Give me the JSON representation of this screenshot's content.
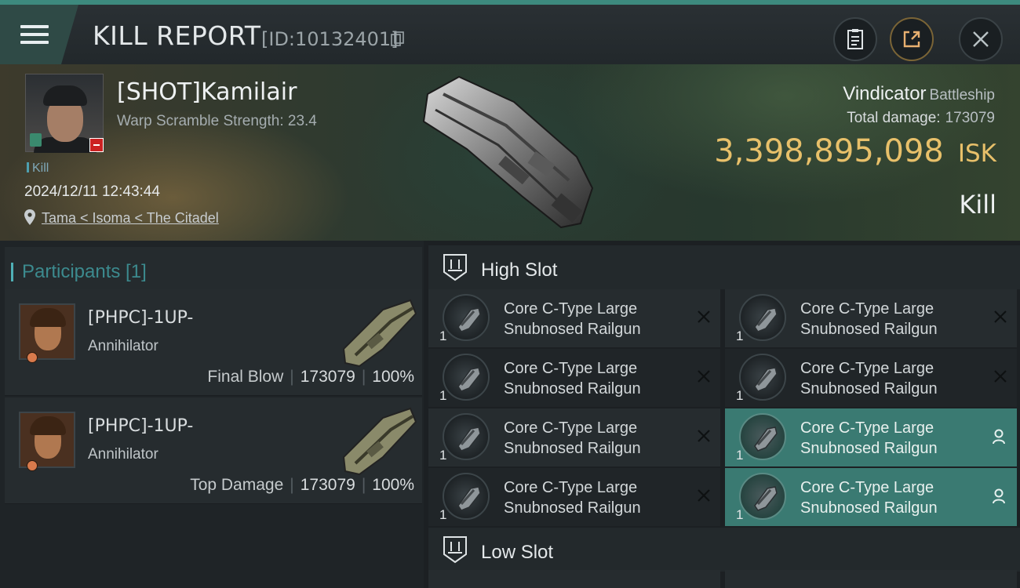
{
  "header": {
    "title": "KILL REPORT",
    "report_id": "[ID:10132401]"
  },
  "victim": {
    "name": "[SHOT]Kamilair",
    "warp_scramble": "Warp Scramble Strength: 23.4",
    "kill_tag": "Kill",
    "datetime": "2024/12/11 12:43:44",
    "location": "Tama < Isoma < The Citadel",
    "ship_name": "Vindicator",
    "ship_class": "Battleship",
    "total_damage_label": "Total damage:",
    "total_damage": "173079",
    "isk_value": "3,398,895,098",
    "isk_unit": "ISK",
    "result": "Kill"
  },
  "participants": {
    "title": "Participants [1]",
    "items": [
      {
        "name": "[PHPC]-1UP-",
        "ship": "Annihilator",
        "role": "Final Blow",
        "damage": "173079",
        "percent": "100%"
      },
      {
        "name": "[PHPC]-1UP-",
        "ship": "Annihilator",
        "role": "Top Damage",
        "damage": "173079",
        "percent": "100%"
      }
    ]
  },
  "slots": {
    "high": {
      "label": "High Slot",
      "modules": [
        {
          "line1": "Core C-Type Large",
          "line2": "Snubnosed Railgun",
          "qty": "1",
          "status": "destroyed"
        },
        {
          "line1": "Core C-Type Large",
          "line2": "Snubnosed Railgun",
          "qty": "1",
          "status": "destroyed"
        },
        {
          "line1": "Core C-Type Large",
          "line2": "Snubnosed Railgun",
          "qty": "1",
          "status": "destroyed"
        },
        {
          "line1": "Core C-Type Large",
          "line2": "Snubnosed Railgun",
          "qty": "1",
          "status": "destroyed"
        },
        {
          "line1": "Core C-Type Large",
          "line2": "Snubnosed Railgun",
          "qty": "1",
          "status": "destroyed"
        },
        {
          "line1": "Core C-Type Large",
          "line2": "Snubnosed Railgun",
          "qty": "1",
          "status": "dropped"
        },
        {
          "line1": "Core C-Type Large",
          "line2": "Snubnosed Railgun",
          "qty": "1",
          "status": "destroyed"
        },
        {
          "line1": "Core C-Type Large",
          "line2": "Snubnosed Railgun",
          "qty": "1",
          "status": "dropped"
        }
      ]
    },
    "low": {
      "label": "Low Slot"
    }
  },
  "colors": {
    "accent_teal": "#3d8a7e",
    "isk_gold": "#e8c06a",
    "dropped_bg": "#3a7a72"
  },
  "icons": {
    "menu": "hamburger-icon",
    "copy": "copy-icon",
    "clipboard": "clipboard-icon",
    "share": "share-icon",
    "close": "close-icon",
    "location": "location-pin-icon",
    "slot": "slot-icon",
    "destroyed": "x-icon",
    "dropped": "person-icon"
  }
}
